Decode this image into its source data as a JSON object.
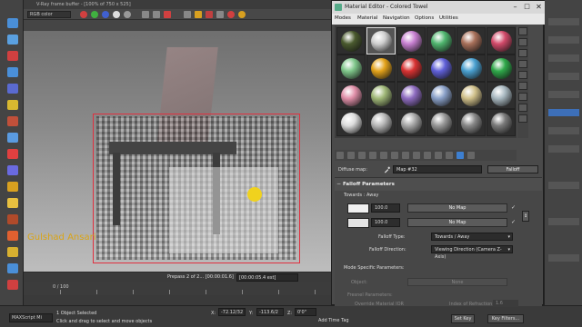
{
  "vfb": {
    "title": "V-Ray frame buffer - [100% of 750 x 525]",
    "channel": "RGB color",
    "watermark": "Gulshad Ansari",
    "prepass": "Prepass 2 of 2...",
    "elapsed": "[00:00:05.4 est]",
    "elapsed_left": "[00:00:01.6]"
  },
  "timeline": {
    "frame": "0 / 100"
  },
  "bottom": {
    "maxscript": "MAXScript Mi",
    "selection": "1 Object Selected",
    "help": "Click and drag to select and move objects",
    "x_label": "X:",
    "x_value": "-72.12/32",
    "y_label": "Y:",
    "y_value": "-113.6/2",
    "z_label": "Z:",
    "z_value": "0'0\"",
    "add_time_tag": "Add Time Tag",
    "set_key": "Set Key",
    "key_filters": "Key Filters..."
  },
  "material_editor": {
    "title": "Material Editor - Colored Towel",
    "menus": [
      "Modes",
      "Material",
      "Navigation",
      "Options",
      "Utilities"
    ],
    "slots": [
      {
        "color": "#4a5a2e"
      },
      {
        "color": "#cfcfcf",
        "active": true
      },
      {
        "color": "#c67fd0"
      },
      {
        "color": "#4fb56e"
      },
      {
        "color": "#a8705a"
      },
      {
        "color": "#d24a6a"
      },
      {
        "color": "#7fc68a"
      },
      {
        "color": "#e3a21a"
      },
      {
        "color": "#d83232"
      },
      {
        "color": "#6060d8"
      },
      {
        "color": "#4aa0d0"
      },
      {
        "color": "#2fa84a"
      },
      {
        "color": "#e08fa8"
      },
      {
        "color": "#a0b878"
      },
      {
        "color": "#8e6cc0"
      },
      {
        "color": "#8aa0c8"
      },
      {
        "color": "#d0c08a"
      },
      {
        "color": "#a8b8c0"
      },
      {
        "color": "#dcdcdc"
      },
      {
        "color": "#b8b8b8"
      },
      {
        "color": "#a8a8a8"
      },
      {
        "color": "#989898"
      },
      {
        "color": "#888888"
      },
      {
        "color": "#7a7a7a"
      }
    ],
    "diffuse_label": "Diffuse map:",
    "map_name": "Map #32",
    "map_type": "Falloff",
    "rollout_title": "Falloff Parameters",
    "towards_away": "Towards : Away",
    "front_value": "100.0",
    "side_value": "100.0",
    "no_map_1": "No Map",
    "no_map_2": "No Map",
    "falloff_type_label": "Falloff Type:",
    "falloff_type_value": "Towards / Away",
    "falloff_dir_label": "Falloff Direction:",
    "falloff_dir_value": "Viewing Direction (Camera Z-Axis)",
    "mode_specific": "Mode Specific Parameters:",
    "object_label": "Object:",
    "object_value": "None",
    "fresnel_label": "Fresnel Parameters:",
    "override_label": "Override Material IOR",
    "ior_label": "Index of Refraction",
    "ior_value": "1.6"
  }
}
